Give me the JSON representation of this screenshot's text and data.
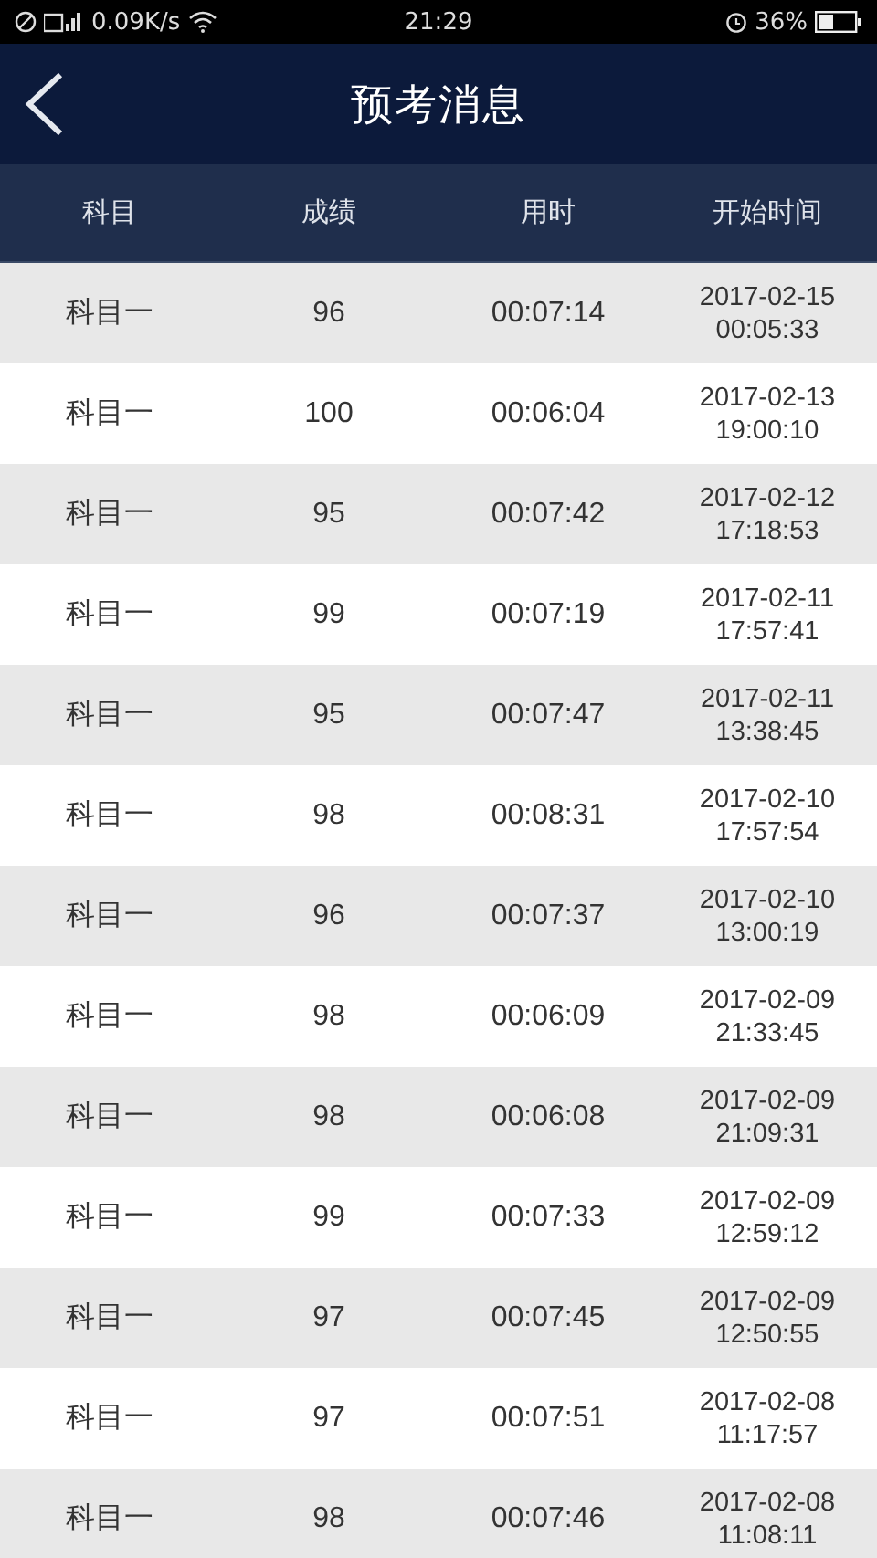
{
  "status_bar": {
    "speed": "0.09K/s",
    "time": "21:29",
    "battery": "36%"
  },
  "header": {
    "title": "预考消息"
  },
  "table": {
    "columns": [
      "科目",
      "成绩",
      "用时",
      "开始时间"
    ],
    "rows": [
      {
        "subject": "科目一",
        "score": "96",
        "duration": "00:07:14",
        "date": "2017-02-15",
        "time": "00:05:33"
      },
      {
        "subject": "科目一",
        "score": "100",
        "duration": "00:06:04",
        "date": "2017-02-13",
        "time": "19:00:10"
      },
      {
        "subject": "科目一",
        "score": "95",
        "duration": "00:07:42",
        "date": "2017-02-12",
        "time": "17:18:53"
      },
      {
        "subject": "科目一",
        "score": "99",
        "duration": "00:07:19",
        "date": "2017-02-11",
        "time": "17:57:41"
      },
      {
        "subject": "科目一",
        "score": "95",
        "duration": "00:07:47",
        "date": "2017-02-11",
        "time": "13:38:45"
      },
      {
        "subject": "科目一",
        "score": "98",
        "duration": "00:08:31",
        "date": "2017-02-10",
        "time": "17:57:54"
      },
      {
        "subject": "科目一",
        "score": "96",
        "duration": "00:07:37",
        "date": "2017-02-10",
        "time": "13:00:19"
      },
      {
        "subject": "科目一",
        "score": "98",
        "duration": "00:06:09",
        "date": "2017-02-09",
        "time": "21:33:45"
      },
      {
        "subject": "科目一",
        "score": "98",
        "duration": "00:06:08",
        "date": "2017-02-09",
        "time": "21:09:31"
      },
      {
        "subject": "科目一",
        "score": "99",
        "duration": "00:07:33",
        "date": "2017-02-09",
        "time": "12:59:12"
      },
      {
        "subject": "科目一",
        "score": "97",
        "duration": "00:07:45",
        "date": "2017-02-09",
        "time": "12:50:55"
      },
      {
        "subject": "科目一",
        "score": "97",
        "duration": "00:07:51",
        "date": "2017-02-08",
        "time": "11:17:57"
      },
      {
        "subject": "科目一",
        "score": "98",
        "duration": "00:07:46",
        "date": "2017-02-08",
        "time": "11:08:11"
      }
    ]
  }
}
